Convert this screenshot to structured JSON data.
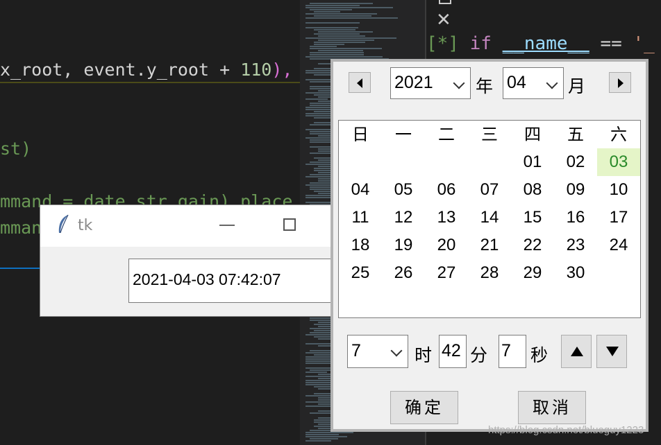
{
  "editor": {
    "code_line_1_pre": "x_root, event.y_root + ",
    "code_line_1_num": "110",
    "code_line_1_post": "),",
    "code_line_2": "st)",
    "code_line_3": "mmand = date_str_gain).place",
    "code_line_4": "mmand",
    "right_code_bracket": "[*]",
    "right_code_kw": "if",
    "right_code_name": "__name__",
    "right_code_op": "==",
    "right_code_str": "'_"
  },
  "tk_window": {
    "title": "tk",
    "entry_value": "2021-04-03 07:42:07"
  },
  "picker": {
    "year_value": "2021",
    "year_label": "年",
    "month_value": "04",
    "month_label": "月",
    "weekdays": [
      "日",
      "一",
      "二",
      "三",
      "四",
      "五",
      "六"
    ],
    "days": [
      [
        "",
        "",
        "",
        "",
        "01",
        "02",
        "03"
      ],
      [
        "04",
        "05",
        "06",
        "07",
        "08",
        "09",
        "10"
      ],
      [
        "11",
        "12",
        "13",
        "14",
        "15",
        "16",
        "17"
      ],
      [
        "18",
        "19",
        "20",
        "21",
        "22",
        "23",
        "24"
      ],
      [
        "25",
        "26",
        "27",
        "28",
        "29",
        "30",
        ""
      ]
    ],
    "selected_day": "03",
    "hour_value": "7",
    "hour_label": "时",
    "minute_value": "42",
    "minute_label": "分",
    "second_value": "7",
    "second_label": "秒",
    "ok_label": "确定",
    "cancel_label": "取消"
  },
  "colors": {
    "selected_day_bg": "#e5f5c8",
    "selected_day_fg": "#2a8a2a"
  },
  "watermark": "https://blog.csdn.net/blueguy1223"
}
